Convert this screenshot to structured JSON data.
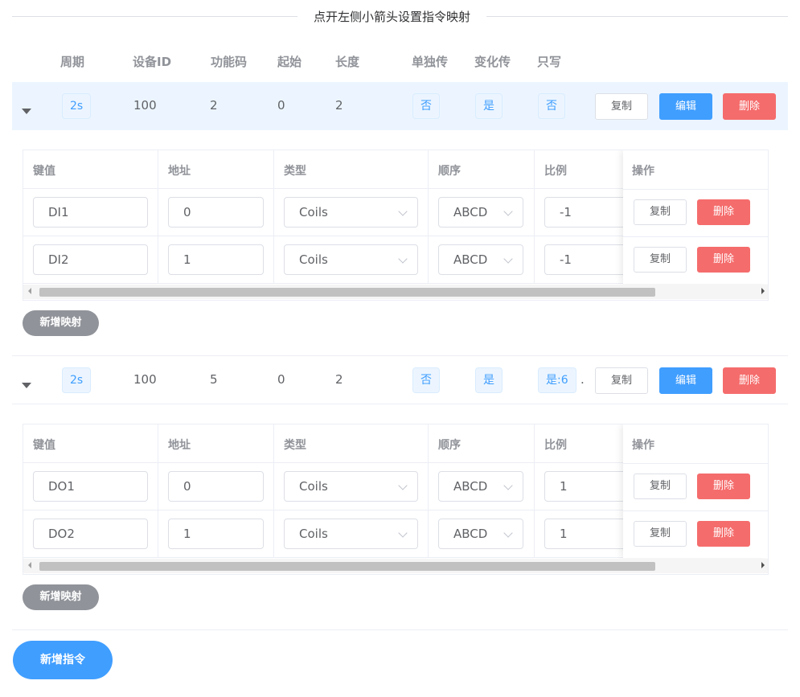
{
  "title": "点开左侧小箭头设置指令映射",
  "headers": [
    "周期",
    "设备ID",
    "功能码",
    "起始",
    "长度",
    "单独传",
    "变化传",
    "只写"
  ],
  "commands": [
    {
      "period": "2s",
      "device_id": "100",
      "func_code": "2",
      "start": "0",
      "length": "2",
      "single": "否",
      "change": "是",
      "write_only": "否",
      "extra": "",
      "buttons": {
        "copy": "复制",
        "edit": "编辑",
        "delete": "删除"
      },
      "mapping": {
        "columns": [
          "键值",
          "地址",
          "类型",
          "顺序",
          "比例",
          "操作"
        ],
        "rows": [
          {
            "key": "DI1",
            "addr": "0",
            "type": "Coils",
            "order": "ABCD",
            "ratio": "-1",
            "copy": "复制",
            "delete": "删除"
          },
          {
            "key": "DI2",
            "addr": "1",
            "type": "Coils",
            "order": "ABCD",
            "ratio": "-1",
            "copy": "复制",
            "delete": "删除"
          }
        ],
        "add_label": "新增映射"
      }
    },
    {
      "period": "2s",
      "device_id": "100",
      "func_code": "5",
      "start": "0",
      "length": "2",
      "single": "否",
      "change": "是",
      "write_only": "是:6",
      "extra": ".",
      "buttons": {
        "copy": "复制",
        "edit": "编辑",
        "delete": "删除"
      },
      "mapping": {
        "columns": [
          "键值",
          "地址",
          "类型",
          "顺序",
          "比例",
          "操作"
        ],
        "rows": [
          {
            "key": "DO1",
            "addr": "0",
            "type": "Coils",
            "order": "ABCD",
            "ratio": "1",
            "copy": "复制",
            "delete": "删除"
          },
          {
            "key": "DO2",
            "addr": "1",
            "type": "Coils",
            "order": "ABCD",
            "ratio": "1",
            "copy": "复制",
            "delete": "删除"
          }
        ],
        "add_label": "新增映射"
      }
    }
  ],
  "add_command_label": "新增指令"
}
